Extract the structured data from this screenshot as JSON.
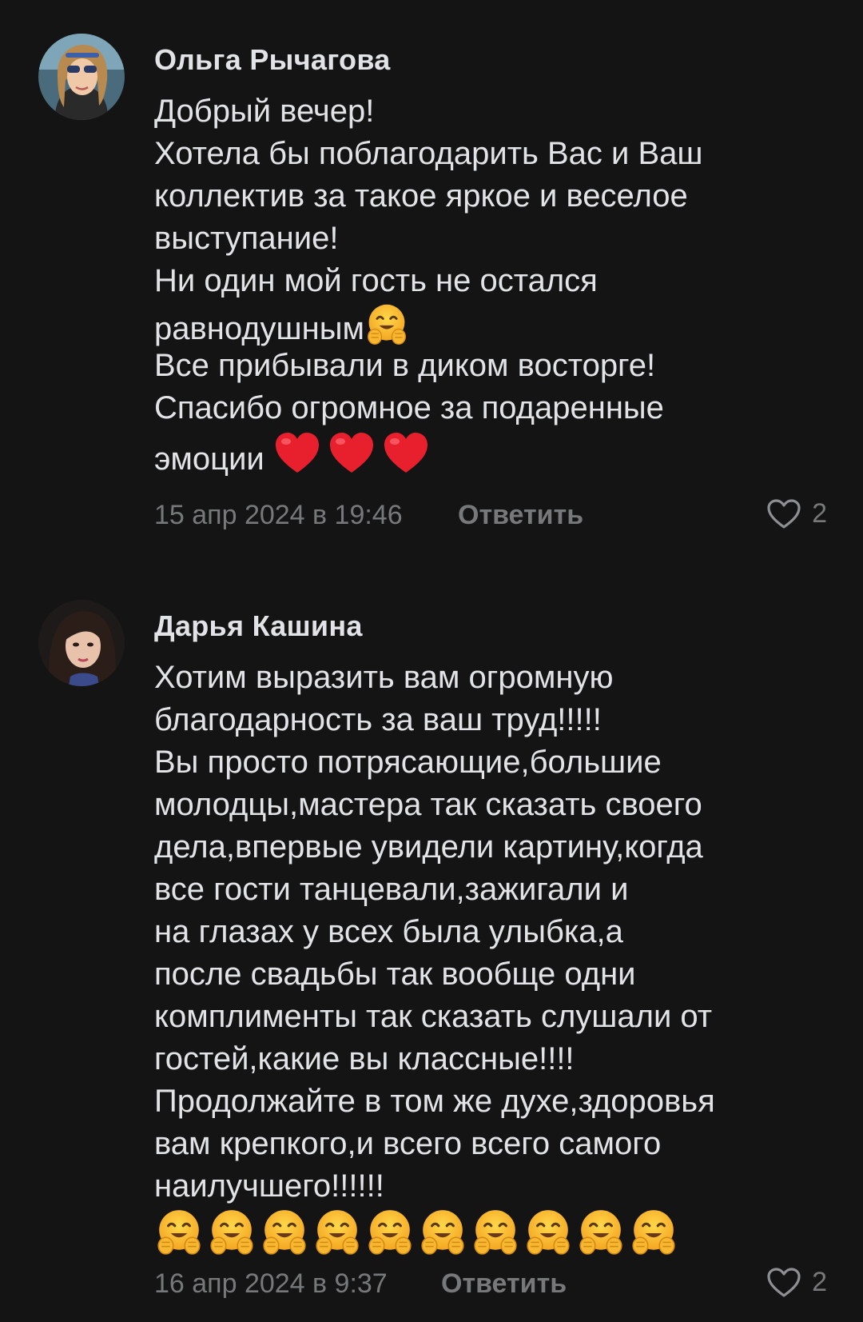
{
  "comments": [
    {
      "author": "Ольга Рычагова",
      "text_lines": [
        "Добрый вечер!",
        "Хотела бы поблагодарить Вас и Ваш",
        "коллектив за такое яркое и веселое",
        "выступание!",
        "Ни один мой гость не остался",
        "равнодушным",
        "Все прибывали в диком восторге!",
        "Спасибо огромное за подаренные",
        "эмоции"
      ],
      "emojis": [
        "hugging-face-emoji",
        "red-heart-emoji",
        "red-heart-emoji",
        "red-heart-emoji"
      ],
      "date": "15 апр 2024 в 19:46",
      "reply_label": "Ответить",
      "likes": "2",
      "like_icon": "heart-outline-icon"
    },
    {
      "author": "Дарья Кашина",
      "text_lines": [
        "Хотим выразить вам огромную",
        "благодарность за ваш труд!!!!!",
        "Вы просто потрясающие,большие",
        "молодцы,мастера так сказать своего",
        "дела,впервые увидели картину,когда",
        "все гости танцевали,зажигали и",
        "на глазах у всех была улыбка,а",
        "после свадьбы так вообще одни",
        "комплименты так сказать слушали от",
        "гостей,какие вы классные!!!!",
        "Продолжайте в том же духе,здоровья",
        "вам крепкого,и всего всего самого",
        "наилучшего!!!!!!"
      ],
      "emojis": [
        "hugging-face-emoji",
        "hugging-face-emoji",
        "hugging-face-emoji",
        "hugging-face-emoji",
        "hugging-face-emoji",
        "hugging-face-emoji",
        "hugging-face-emoji",
        "hugging-face-emoji",
        "hugging-face-emoji",
        "hugging-face-emoji"
      ],
      "date": "16 апр 2024 в 9:37",
      "reply_label": "Ответить",
      "likes": "2",
      "like_icon": "heart-outline-icon"
    }
  ],
  "colors": {
    "background": "#141414",
    "text": "#e1e3e6",
    "secondary": "#76787a"
  }
}
